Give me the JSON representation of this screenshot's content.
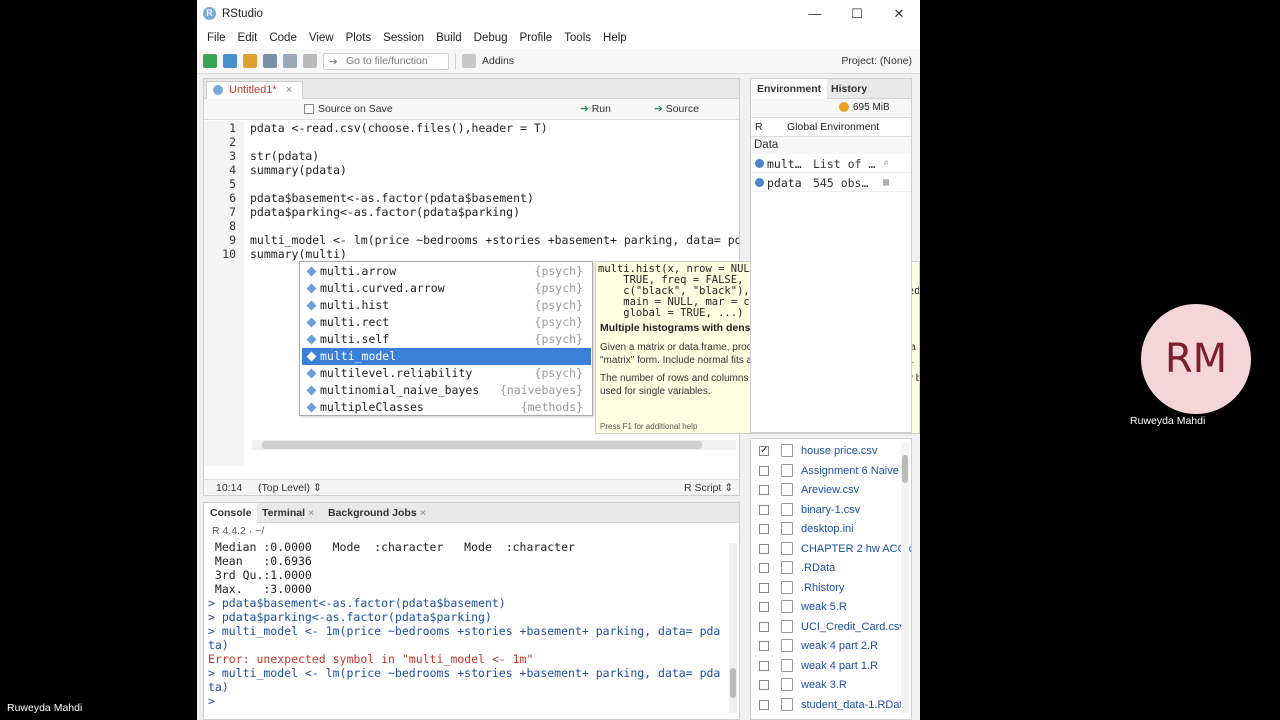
{
  "window": {
    "title": "RStudio",
    "icon_letter": "R",
    "minimize": "—",
    "maximize": "☐",
    "close": "✕"
  },
  "menu": [
    "File",
    "Edit",
    "Code",
    "View",
    "Plots",
    "Session",
    "Build",
    "Debug",
    "Profile",
    "Tools",
    "Help"
  ],
  "toolbar": {
    "goto_placeholder": "Go to file/function",
    "addins": "Addins",
    "project": "Project: (None)"
  },
  "source": {
    "tab_label": "Untitled1*",
    "source_on_save": "Source on Save",
    "run": "Run",
    "source": "Source",
    "lines": [
      {
        "n": "1",
        "code": "pdata <-read.csv(choose.files(),header = T)"
      },
      {
        "n": "2",
        "code": ""
      },
      {
        "n": "3",
        "code": "str(pdata)"
      },
      {
        "n": "4",
        "code": "summary(pdata)"
      },
      {
        "n": "5",
        "code": ""
      },
      {
        "n": "6",
        "code": "pdata$basement<-as.factor(pdata$basement)"
      },
      {
        "n": "7",
        "code": "pdata$parking<-as.factor(pdata$parking)"
      },
      {
        "n": "8",
        "code": ""
      },
      {
        "n": "9",
        "code": "multi_model <- lm(price ~bedrooms +stories +basement+ parking, data= pd"
      },
      {
        "n": "10",
        "code": "summary(multi)"
      }
    ],
    "status_position": "10:14",
    "status_scope": "(Top Level) ⇕",
    "status_type": "R Script ⇕"
  },
  "completions": [
    {
      "name": "multi.arrow",
      "pkg": "{psych}"
    },
    {
      "name": "multi.curved.arrow",
      "pkg": "{psych}"
    },
    {
      "name": "multi.hist",
      "pkg": "{psych}"
    },
    {
      "name": "multi.rect",
      "pkg": "{psych}"
    },
    {
      "name": "multi.self",
      "pkg": "{psych}"
    },
    {
      "name": "multi_model",
      "pkg": ""
    },
    {
      "name": "multilevel.reliability",
      "pkg": "{psych}"
    },
    {
      "name": "multinomial_naive_bayes",
      "pkg": "{naivebayes}"
    },
    {
      "name": "multipleClasses",
      "pkg": "{methods}"
    }
  ],
  "help": {
    "signature": "multi.hist(x, nrow = NULL, ncol = NULL, density =\n    TRUE, freq = FALSE, bcol = \"white\", dcol =\n    c(\"black\", \"black\"), dlty = c(\"dashed\", \"dotted\"\n    main = NULL, mar = c(2, 1, 1, 1), breaks = 21,\n    global = TRUE, ...)",
    "title": "Multiple histograms with density and normal fits on one page",
    "p1": "Given a matrix or data.frame, produce histograms for each variable in a \"matrix\" form. Include normal fits and density distributions for each plot.",
    "p2": "The number of rows and columns may be specified, or calculated. May be used for single variables.",
    "footer": "Press F1 for additional help"
  },
  "console": {
    "tabs": [
      "Console",
      "Terminal",
      "Background Jobs"
    ],
    "r_version": "R 4.4.2 · ~/",
    "lines": [
      {
        "t": "out",
        "text": " Median :0.0000   Mode  :character   Mode  :character"
      },
      {
        "t": "out",
        "text": " Mean   :0.6936"
      },
      {
        "t": "out",
        "text": " 3rd Qu.:1.0000"
      },
      {
        "t": "out",
        "text": " Max.   :3.0000"
      },
      {
        "t": "cmd",
        "text": "> pdata$basement<-as.factor(pdata$basement)"
      },
      {
        "t": "cmd",
        "text": "> pdata$parking<-as.factor(pdata$parking)"
      },
      {
        "t": "cmd",
        "text": "> multi_model <- 1m(price ~bedrooms +stories +basement+ parking, data= pda"
      },
      {
        "t": "cmd",
        "text": "ta)"
      },
      {
        "t": "err",
        "text": "Error: unexpected symbol in \"multi_model <- 1m\""
      },
      {
        "t": "cmd",
        "text": "> multi_model <- lm(price ~bedrooms +stories +basement+ parking, data= pda"
      },
      {
        "t": "cmd",
        "text": "ta)"
      },
      {
        "t": "cmd",
        "text": "> "
      }
    ]
  },
  "environment": {
    "tabs": [
      "Environment",
      "History"
    ],
    "memory": "695 MiB",
    "lang": "R",
    "scope": "Global Environment",
    "section": "Data",
    "rows": [
      {
        "name": "mult…",
        "value": "List of …"
      },
      {
        "name": "pdata",
        "value": "545 obs…"
      }
    ]
  },
  "files": [
    {
      "name": "house price.csv",
      "checked": true
    },
    {
      "name": "Assignment 6 Naive",
      "checked": false
    },
    {
      "name": "Areview.csv",
      "checked": false
    },
    {
      "name": "binary-1.csv",
      "checked": false
    },
    {
      "name": "desktop.ini",
      "checked": false
    },
    {
      "name": "CHAPTER 2 hw ACC.c",
      "checked": false
    },
    {
      "name": ".RData",
      "checked": false
    },
    {
      "name": ".Rhistory",
      "checked": false
    },
    {
      "name": "weak 5.R",
      "checked": false
    },
    {
      "name": "UCI_Credit_Card.csv",
      "checked": false
    },
    {
      "name": "weak 4 part 2.R",
      "checked": false
    },
    {
      "name": "weak 4 part 1.R",
      "checked": false
    },
    {
      "name": "weak 3.R",
      "checked": false
    },
    {
      "name": "student_data-1.RData",
      "checked": false
    }
  ],
  "meeting": {
    "presenter": "Ruweyda Mahdi",
    "avatar_initials": "RM",
    "participant": "Ruweyda Mahdi"
  }
}
